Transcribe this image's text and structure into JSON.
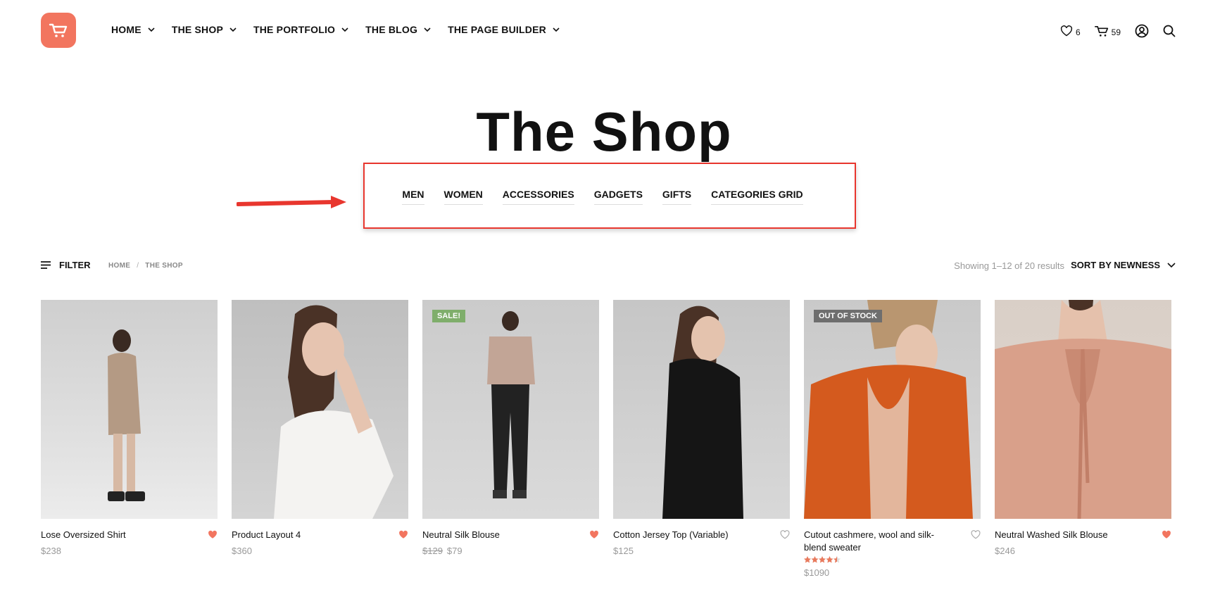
{
  "header": {
    "nav": [
      {
        "label": "HOME"
      },
      {
        "label": "THE SHOP"
      },
      {
        "label": "THE PORTFOLIO"
      },
      {
        "label": "THE BLOG"
      },
      {
        "label": "THE PAGE BUILDER"
      }
    ],
    "wishlist_count": "6",
    "cart_count": "59"
  },
  "page_title": "The Shop",
  "categories": [
    "MEN",
    "WOMEN",
    "ACCESSORIES",
    "GADGETS",
    "GIFTS",
    "CATEGORIES GRID"
  ],
  "toolbar": {
    "filter_label": "FILTER",
    "breadcrumb": [
      "HOME",
      "THE SHOP"
    ],
    "breadcrumb_sep": "/",
    "results_text": "Showing 1–12 of 20 results",
    "sort_label": "SORT BY NEWNESS"
  },
  "products": [
    {
      "name": "Lose Oversized Shirt",
      "price": "$238",
      "liked": true
    },
    {
      "name": "Product Layout 4",
      "price": "$360",
      "liked": true
    },
    {
      "name": "Neutral Silk Blouse",
      "old_price": "$129",
      "price": "$79",
      "badge": "SALE!",
      "liked": true
    },
    {
      "name": "Cotton Jersey Top (Variable)",
      "price": "$125",
      "liked": false
    },
    {
      "name": "Cutout cashmere, wool and silk-blend sweater",
      "price": "$1090",
      "badge": "OUT OF STOCK",
      "rating": 4.5,
      "liked": false
    },
    {
      "name": "Neutral Washed Silk Blouse",
      "price": "$246",
      "liked": true
    }
  ],
  "colors": {
    "accent": "#f2755f",
    "annotation": "#e8362e",
    "sale": "#7fae6b",
    "out_of_stock": "#6e6e6e"
  }
}
